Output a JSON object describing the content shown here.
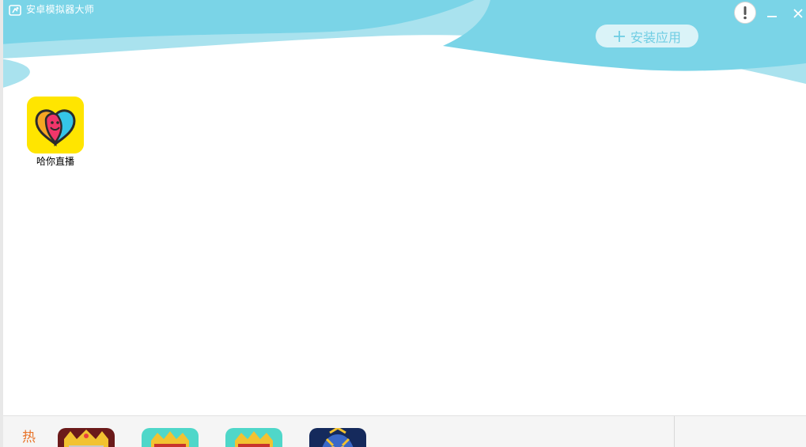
{
  "window": {
    "title": "安卓模拟器大师",
    "accent_color": "#78d3e6",
    "accent_color_light": "#a8e2ee"
  },
  "titlebar": {
    "info_icon": "exclamation-icon",
    "minimize_icon": "minimize-icon",
    "close_icon": "close-icon"
  },
  "toolbar": {
    "install_label": "安装应用",
    "install_icon": "plus-icon"
  },
  "apps": [
    {
      "label": "哈你直播",
      "icon": "heart-smile-app-icon",
      "icon_bg": "#ffe500"
    }
  ],
  "hot_bar": {
    "label": "热",
    "label_color": "#e8752c",
    "games": [
      {
        "icon": "game-icon-king-armored"
      },
      {
        "icon": "game-icon-king-teal"
      },
      {
        "icon": "game-icon-king-teal-2"
      },
      {
        "icon": "game-icon-blue-warrior"
      }
    ]
  }
}
